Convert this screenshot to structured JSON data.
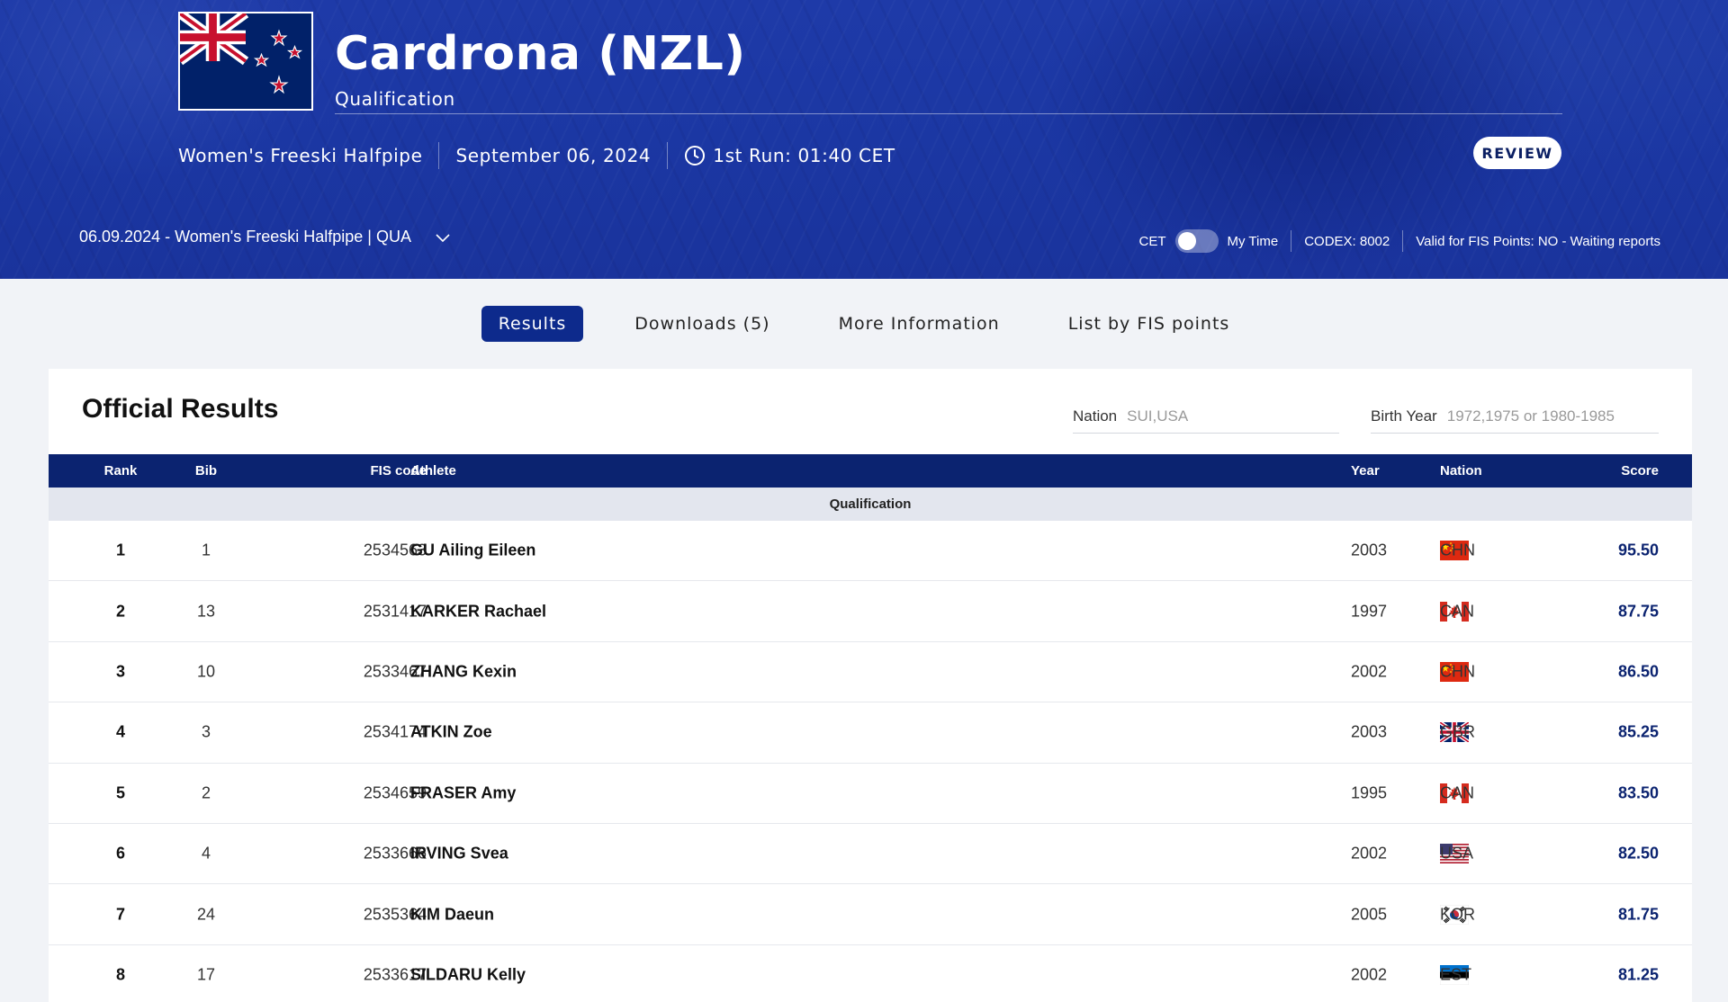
{
  "event": {
    "title": "Cardrona (NZL)",
    "subtitle": "Qualification",
    "discipline": "Women's Freeski Halfpipe",
    "date": "September 06, 2024",
    "first_run": "1st Run: 01:40 CET",
    "review_label": "REVIEW",
    "race_selector": "06.09.2024 - Women's Freeski Halfpipe | QUA",
    "tz_cet": "CET",
    "tz_mytime": "My Time",
    "codex": "CODEX: 8002",
    "fis_points_status": "Valid for FIS Points: NO - Waiting reports",
    "host_flag": "nzl-flag-icon"
  },
  "tabs": [
    {
      "label": "Results",
      "active": true
    },
    {
      "label": "Downloads (5)",
      "active": false
    },
    {
      "label": "More Information",
      "active": false
    },
    {
      "label": "List by FIS points",
      "active": false
    }
  ],
  "results": {
    "title": "Official Results",
    "filters": {
      "nation_label": "Nation",
      "nation_placeholder": "SUI,USA",
      "birth_label": "Birth Year",
      "birth_placeholder": "1972,1975 or 1980-1985"
    },
    "columns": {
      "rank": "Rank",
      "bib": "Bib",
      "fis": "FIS code",
      "athlete": "Athlete",
      "year": "Year",
      "nation": "Nation",
      "score": "Score"
    },
    "section": "Qualification",
    "rows": [
      {
        "rank": "1",
        "bib": "1",
        "fis": "2534563",
        "athlete": "GU Ailing Eileen",
        "year": "2003",
        "nation": "CHN",
        "score": "95.50"
      },
      {
        "rank": "2",
        "bib": "13",
        "fis": "2531417",
        "athlete": "KARKER Rachael",
        "year": "1997",
        "nation": "CAN",
        "score": "87.75"
      },
      {
        "rank": "3",
        "bib": "10",
        "fis": "2533467",
        "athlete": "ZHANG Kexin",
        "year": "2002",
        "nation": "CHN",
        "score": "86.50"
      },
      {
        "rank": "4",
        "bib": "3",
        "fis": "2534174",
        "athlete": "ATKIN Zoe",
        "year": "2003",
        "nation": "GBR",
        "score": "85.25"
      },
      {
        "rank": "5",
        "bib": "2",
        "fis": "2534659",
        "athlete": "FRASER Amy",
        "year": "1995",
        "nation": "CAN",
        "score": "83.50"
      },
      {
        "rank": "6",
        "bib": "4",
        "fis": "2533666",
        "athlete": "IRVING Svea",
        "year": "2002",
        "nation": "USA",
        "score": "82.50"
      },
      {
        "rank": "7",
        "bib": "24",
        "fis": "2535364",
        "athlete": "KIM Daeun",
        "year": "2005",
        "nation": "KOR",
        "score": "81.75"
      },
      {
        "rank": "8",
        "bib": "17",
        "fis": "2533617",
        "athlete": "SILDARU Kelly",
        "year": "2002",
        "nation": "EST",
        "score": "81.25"
      }
    ]
  }
}
